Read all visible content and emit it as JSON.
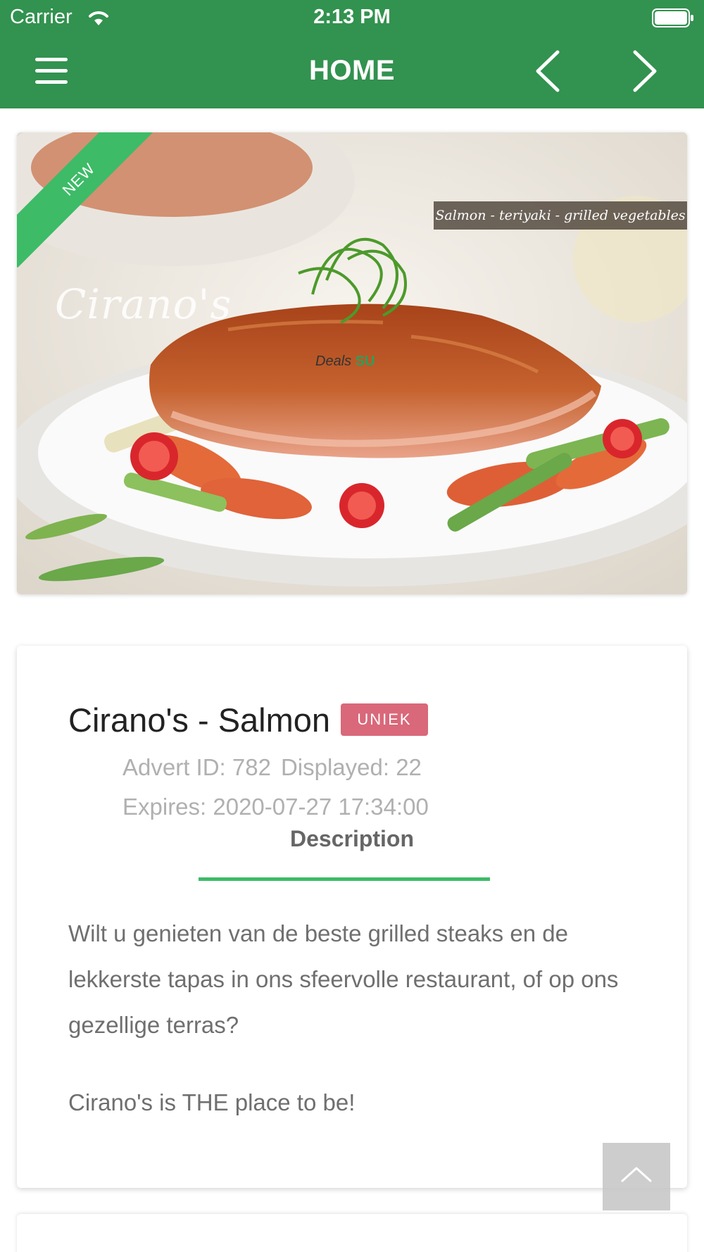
{
  "status_bar": {
    "carrier": "Carrier",
    "time": "2:13 PM"
  },
  "header": {
    "title": "HOME",
    "background_color": "#32924f"
  },
  "hero": {
    "ribbon_label": "NEW",
    "caption": "Salmon - teriyaki - grilled vegetables",
    "brand_mark": "Cirano's",
    "watermark": {
      "prefix": "Deals",
      "suffix": "SU"
    }
  },
  "listing": {
    "title": "Cirano's - Salmon",
    "badge": "UNIEK",
    "advert_id": "Advert ID: 782",
    "displayed": "Displayed: 22",
    "expires": "Expires: 2020-07-27 17:34:00",
    "tab_label": "Description",
    "description": "Wilt u genieten van de beste grilled steaks en de lekkerste tapas in ons sfeervolle restaurant, of op ons gezellige terras?",
    "tagline": "Cirano's is THE place to be!"
  },
  "colors": {
    "accent": "#3dbb67",
    "badge": "#d9687a"
  },
  "icons": {
    "menu": "menu-icon",
    "prev": "chevron-left-icon",
    "next": "chevron-right-icon",
    "scroll_top": "chevron-up-icon"
  }
}
